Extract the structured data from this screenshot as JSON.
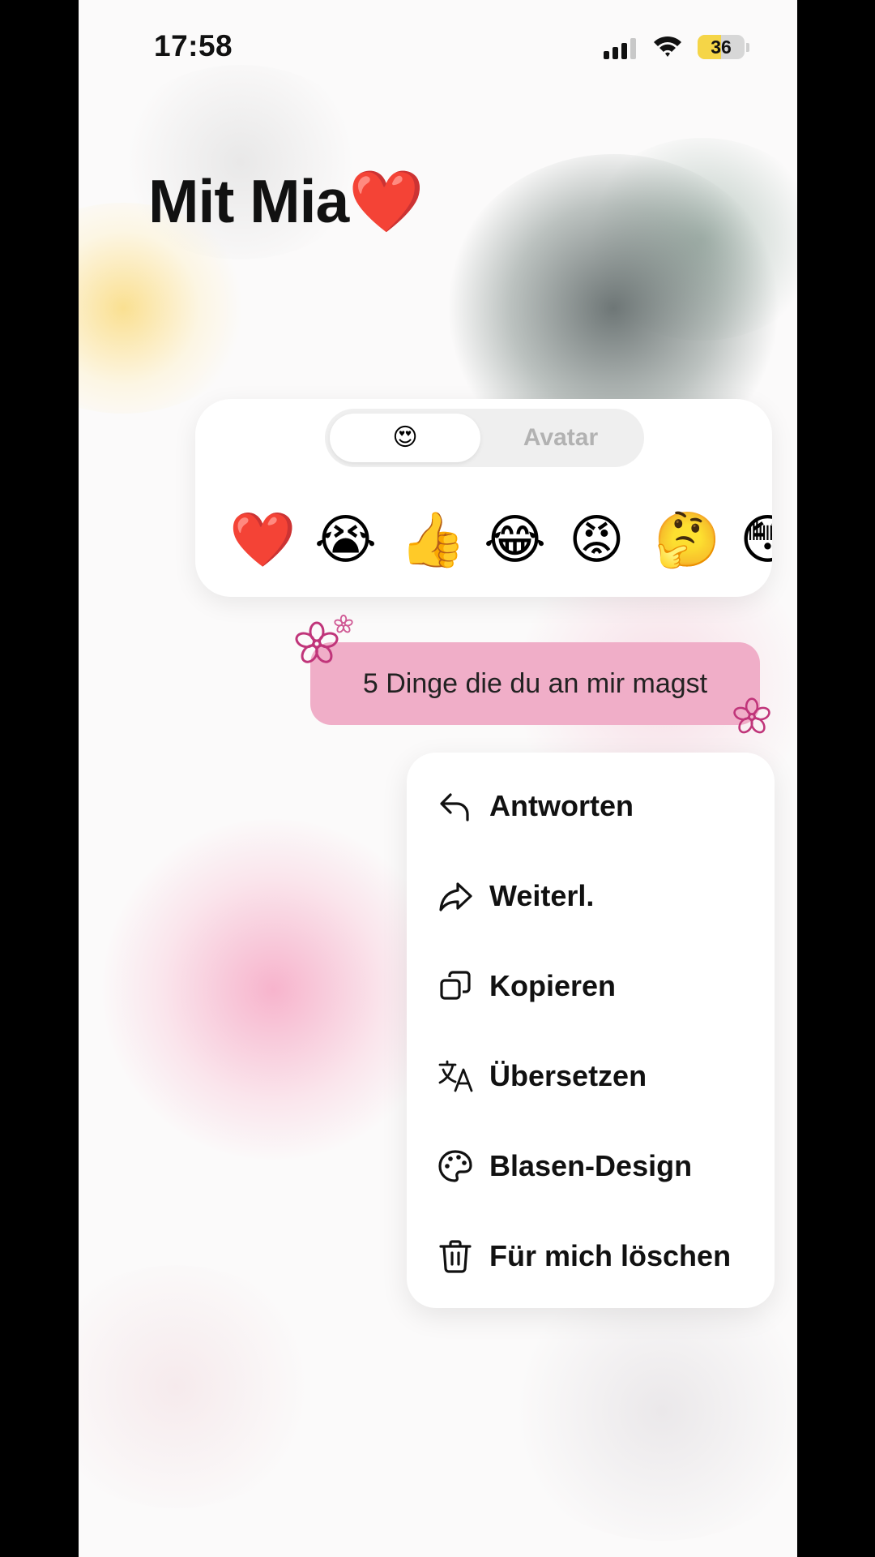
{
  "status_bar": {
    "time": "17:58",
    "battery_level": "36",
    "battery_fraction": 0.5,
    "icons": [
      "cellular-signal-icon",
      "wifi-icon",
      "battery-icon"
    ]
  },
  "header": {
    "title": "Mit Mia❤️"
  },
  "reaction_panel": {
    "tabs": [
      {
        "label": "😍",
        "active": true
      },
      {
        "label": "Avatar",
        "active": false
      }
    ],
    "emojis": [
      "❤️",
      "😭",
      "👍",
      "😂",
      "😡",
      "🤔",
      "😳"
    ]
  },
  "message": {
    "text": "5 Dinge die du an mir magst",
    "bubble_color": "#f0aec8"
  },
  "context_menu": {
    "items": [
      {
        "label": "Antworten",
        "icon": "reply-icon"
      },
      {
        "label": "Weiterl.",
        "icon": "forward-icon"
      },
      {
        "label": "Kopieren",
        "icon": "copy-icon"
      },
      {
        "label": "Übersetzen",
        "icon": "translate-icon"
      },
      {
        "label": "Blasen-Design",
        "icon": "palette-icon"
      },
      {
        "label": "Für mich löschen",
        "icon": "trash-icon"
      }
    ]
  },
  "colors": {
    "accent_pink": "#f0aec8",
    "flower": "#c0357a",
    "battery_yellow": "#f5d547"
  }
}
